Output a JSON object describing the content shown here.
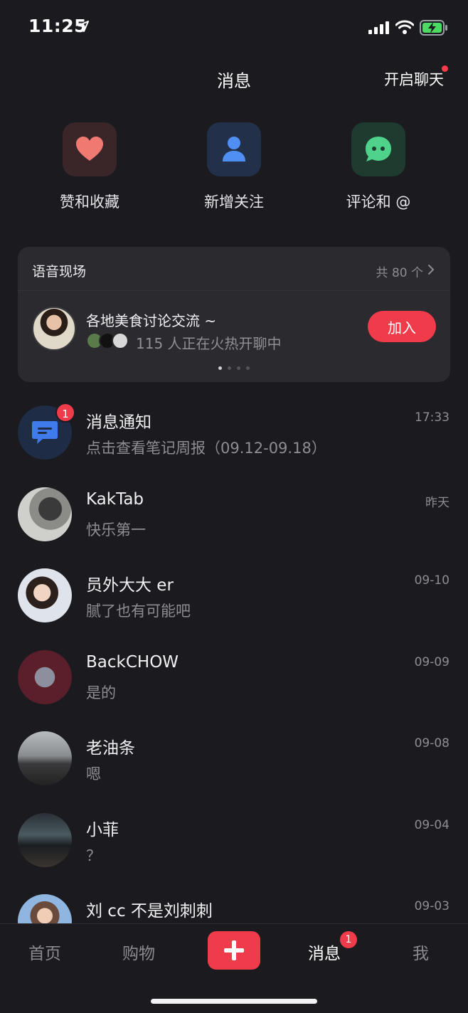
{
  "status_bar": {
    "time": "11:25"
  },
  "header": {
    "title": "消息",
    "right_action": "开启聊天"
  },
  "quick_actions": [
    {
      "label": "赞和收藏",
      "icon": "heart-icon",
      "bg": "#3a2628",
      "color": "#f07a72"
    },
    {
      "label": "新增关注",
      "icon": "person-icon",
      "bg": "#22304a",
      "color": "#4f8ef2"
    },
    {
      "label": "评论和 @",
      "icon": "comment-icon",
      "bg": "#1f3a2e",
      "color": "#4fd38a"
    }
  ],
  "voice": {
    "title": "语音现场",
    "count": "共 80 个",
    "room": {
      "name": "各地美食讨论交流 ~",
      "status": "115 人正在火热开聊中",
      "join_label": "加入"
    }
  },
  "chats": [
    {
      "name": "消息通知",
      "preview": "点击查看笔记周报（09.12-09.18）",
      "time": "17:33",
      "badge": "1",
      "avatar": "notification-icon"
    },
    {
      "name": "KakTab",
      "preview": "快乐第一",
      "time": "昨天"
    },
    {
      "name": "员外大大 er",
      "preview": "腻了也有可能吧",
      "time": "09-10"
    },
    {
      "name": "BackCHOW",
      "preview": "是的",
      "time": "09-09"
    },
    {
      "name": "老油条",
      "preview": "嗯",
      "time": "09-08"
    },
    {
      "name": "小菲",
      "preview": "？",
      "time": "09-04"
    },
    {
      "name": "刘 cc 不是刘刺刺",
      "preview": "",
      "time": "09-03"
    }
  ],
  "tab_bar": {
    "tabs": [
      "首页",
      "购物",
      "消息",
      "我"
    ],
    "active": "消息",
    "message_badge": "1"
  },
  "colors": {
    "accent": "#ef3b4a",
    "background": "#1b1b1f"
  }
}
